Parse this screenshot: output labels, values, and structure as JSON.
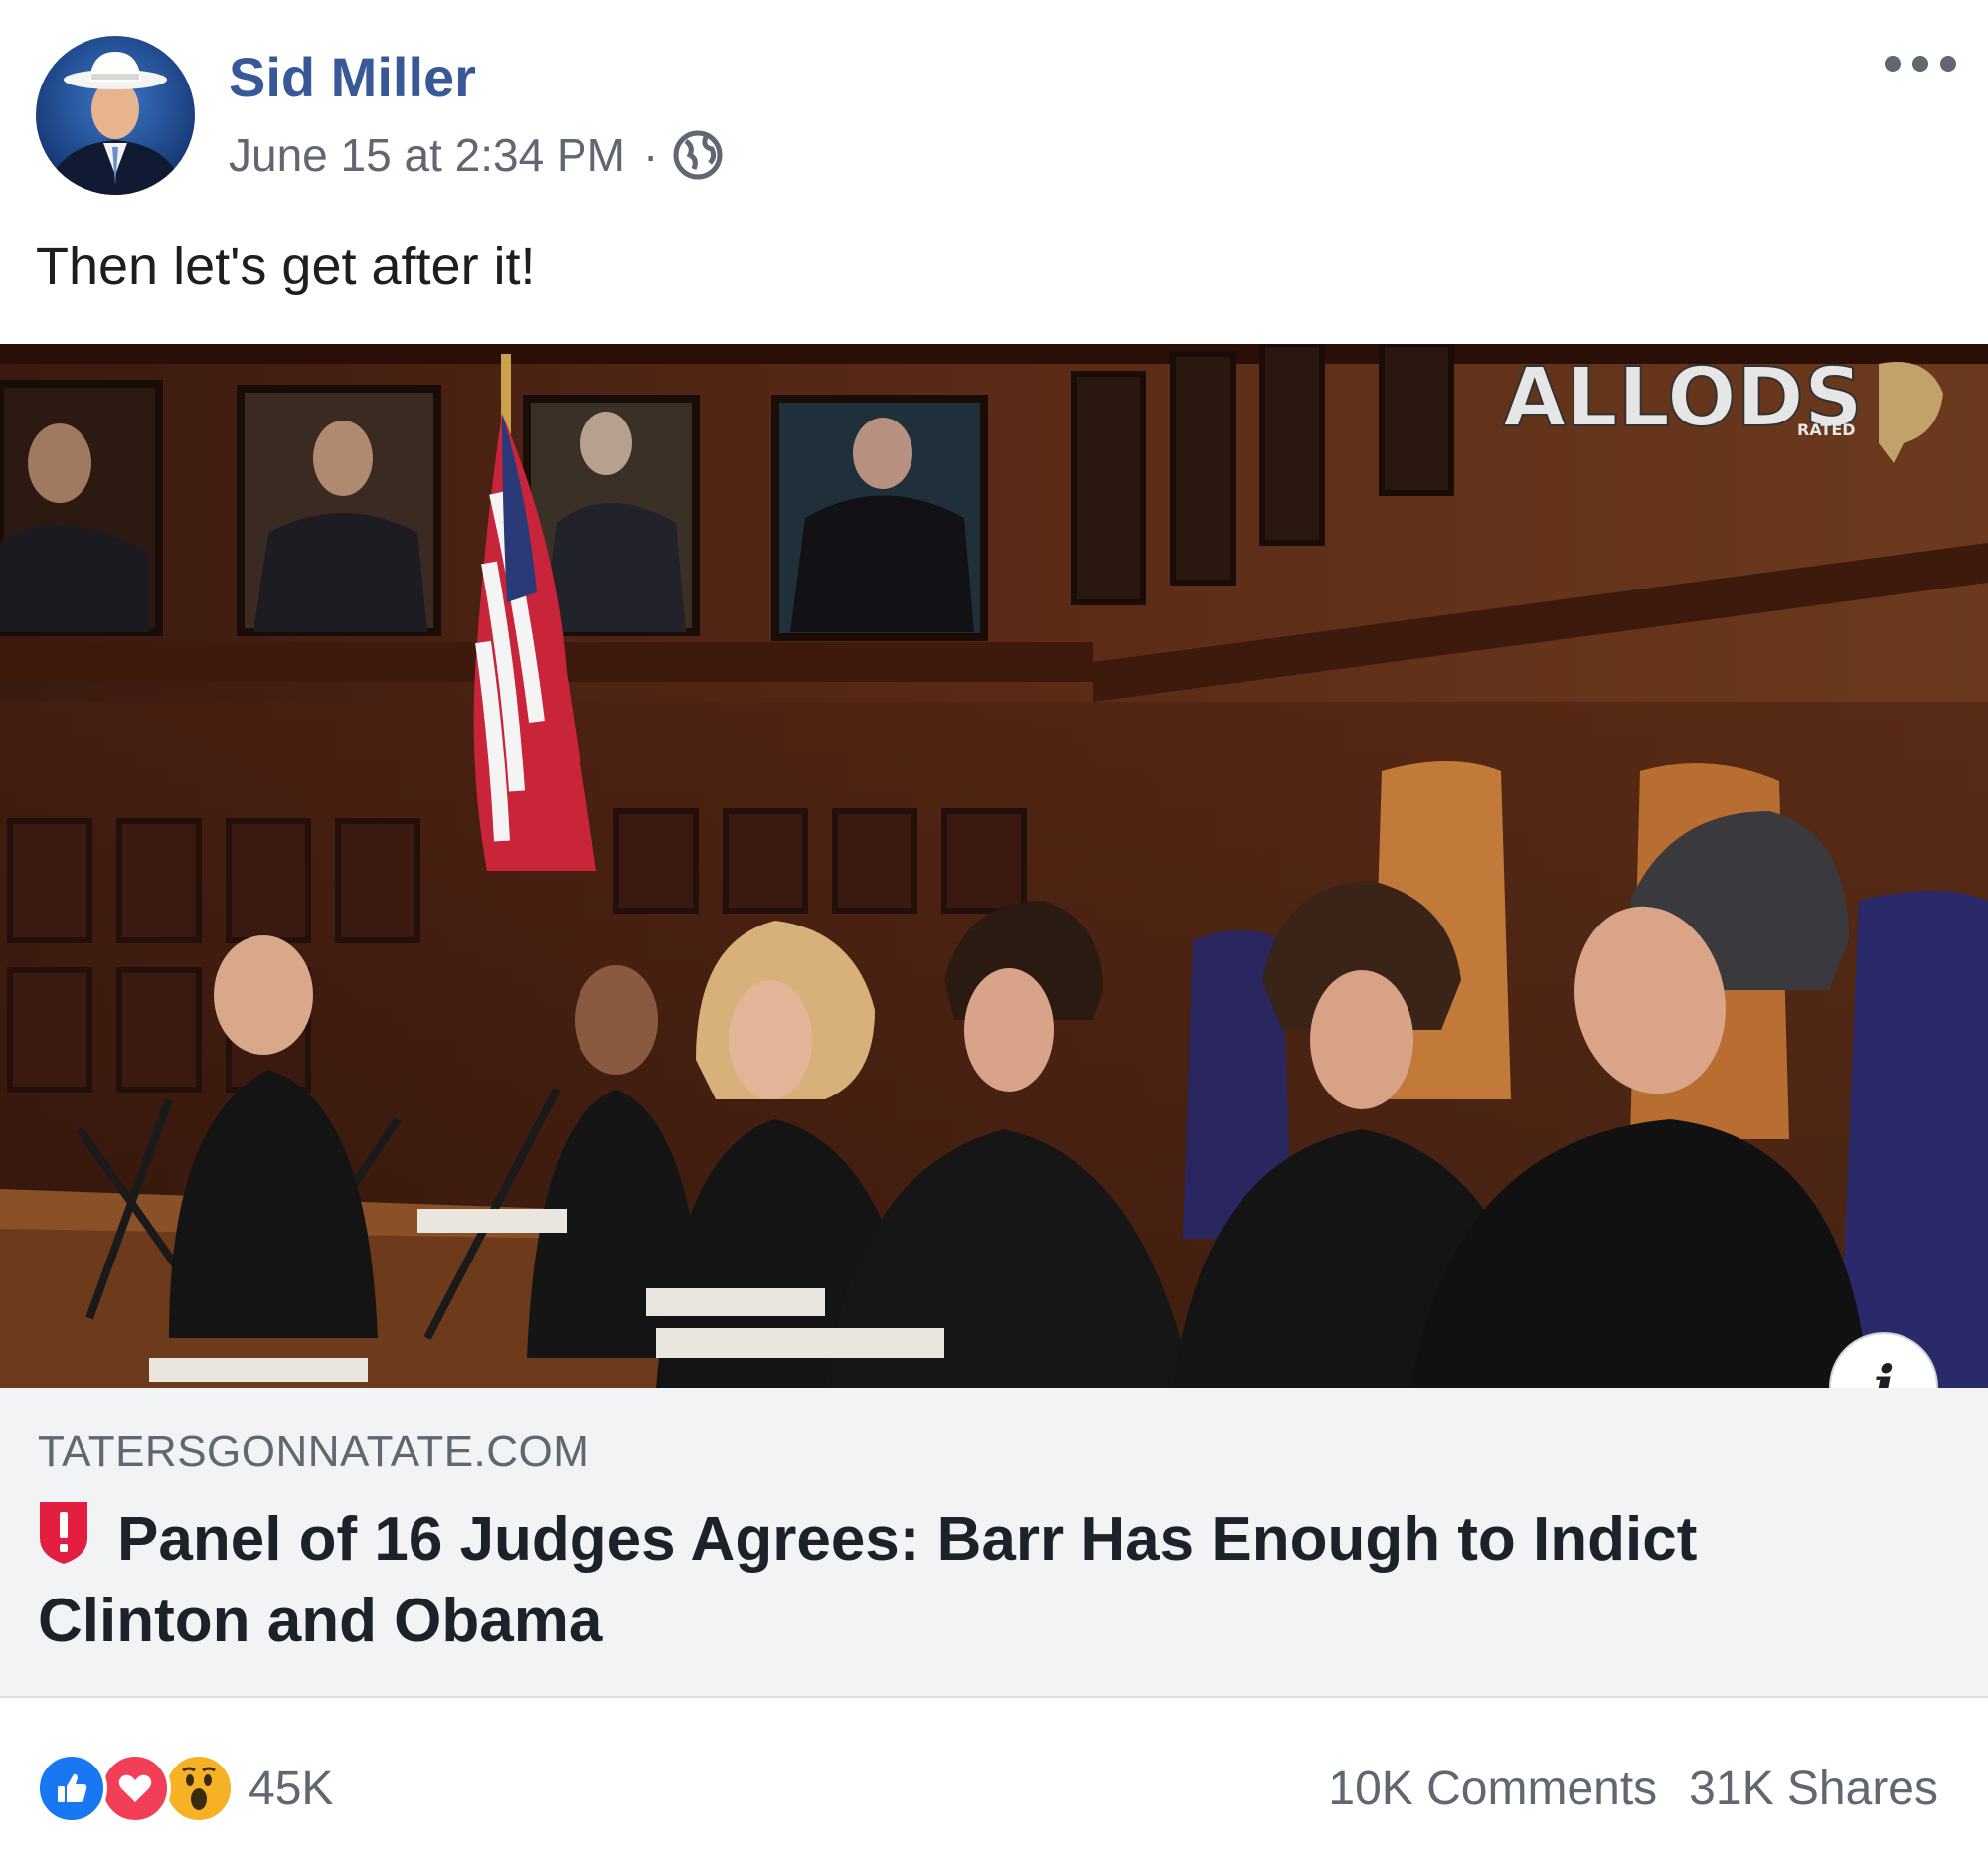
{
  "post": {
    "author": "Sid Miller",
    "timestamp": "June 15 at 2:34 PM",
    "separator": "·",
    "privacy_icon": "globe-icon",
    "more_icon": "more-options-icon",
    "message": "Then let's get after it!"
  },
  "image": {
    "watermark": "ALLODS",
    "watermark_sub": "RATED"
  },
  "link": {
    "domain": "TATERSGONNATATE.COM",
    "title": "Panel of 16 Judges Agrees: Barr Has Enough to Indict Clinton and Obama",
    "warning_icon": "shield-warning-icon",
    "info_icon": "info-icon"
  },
  "footer": {
    "reaction_icons": [
      "like-icon",
      "love-icon",
      "wow-icon"
    ],
    "reaction_count": "45K",
    "comments": "10K Comments",
    "shares": "31K Shares"
  },
  "colors": {
    "author_link": "#385898",
    "secondary_text": "#606770",
    "link_background": "#f2f3f5",
    "like": "#1877f2",
    "love": "#f33e58",
    "wow": "#f7b125",
    "warning": "#e41e3f"
  }
}
